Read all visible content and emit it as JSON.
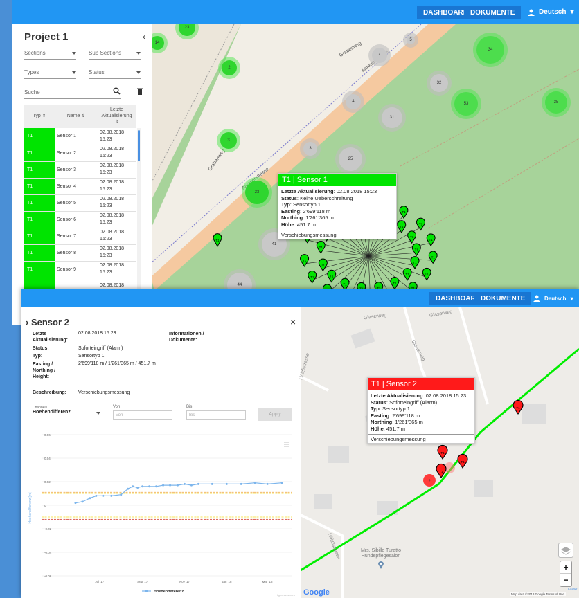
{
  "colors": {
    "topbar": "#2196f3",
    "nav_button": "#1976d2",
    "ok": "#00e400",
    "alarm": "#ff1a1a",
    "map_green": "#a7d39a"
  },
  "window1": {
    "nav": {
      "dashboard": "DASHBOARD",
      "dokumente": "DOKUMENTE",
      "language": "Deutsch"
    },
    "sidebar": {
      "title": "Project 1",
      "filters": {
        "sections": "Sections",
        "sub_sections": "Sub Sections",
        "types": "Types",
        "status": "Status",
        "search_placeholder": "Suche"
      },
      "headers": {
        "typ": "Typ",
        "name": "Name",
        "updated": "Letzte Aktualisierung"
      },
      "rows": [
        {
          "typ": "T1",
          "name": "Sensor 1",
          "date": "02.08.2018",
          "time": "15:23"
        },
        {
          "typ": "T1",
          "name": "Sensor 2",
          "date": "02.08.2018",
          "time": "15:23"
        },
        {
          "typ": "T1",
          "name": "Sensor 3",
          "date": "02.08.2018",
          "time": "15:23"
        },
        {
          "typ": "T1",
          "name": "Sensor 4",
          "date": "02.08.2018",
          "time": "15:23"
        },
        {
          "typ": "T1",
          "name": "Sensor 5",
          "date": "02.08.2018",
          "time": "15:23"
        },
        {
          "typ": "T1",
          "name": "Sensor 6",
          "date": "02.08.2018",
          "time": "15:23"
        },
        {
          "typ": "T1",
          "name": "Sensor 7",
          "date": "02.08.2018",
          "time": "15:23"
        },
        {
          "typ": "T1",
          "name": "Sensor 8",
          "date": "02.08.2018",
          "time": "15:23"
        },
        {
          "typ": "T1",
          "name": "Sensor 9",
          "date": "02.08.2018",
          "time": "15:23"
        },
        {
          "typ": "",
          "name": "",
          "date": "02.08.2018",
          "time": ""
        }
      ]
    },
    "map": {
      "street_labels": [
        "Grabenweg",
        "Aarauerstrasse",
        "Aarauerstrasse",
        "Grabenweg"
      ],
      "clusters": [
        "23",
        "2",
        "4",
        "34",
        "32",
        "53",
        "35",
        "4",
        "31",
        "3",
        "3",
        "25",
        "23",
        "41",
        "44",
        "14",
        "5"
      ],
      "popup": {
        "title": "T1 | Sensor 1",
        "updated_label": "Letzte Aktualisierung",
        "updated_value": "02.08.2018 15:23",
        "status_label": "Status",
        "status_value": "Keine Ueberschreitung",
        "typ_label": "Typ",
        "typ_value": "Sensortyp 1",
        "easting_label": "Easting",
        "easting_value": "2'699'118 m",
        "northing_label": "Northing",
        "northing_value": "1'261'365 m",
        "hoehe_label": "Höhe",
        "hoehe_value": "451.7 m",
        "footer": "Verschiebungsmessung"
      },
      "marker_label": "T1"
    }
  },
  "window2": {
    "nav": {
      "dashboard": "DASHBOARD",
      "dokumente": "DOKUMENTE",
      "language": "Deutsch"
    },
    "detail": {
      "title": "› Sensor 2",
      "close": "×",
      "updated_label": "Letzte Aktualisierung:",
      "updated_value": "02.08.2018 15:23",
      "info_label": "Informationen / Dokumente:",
      "status_label": "Status:",
      "status_value": "Soforteingriff (Alarm)",
      "typ_label": "Typ:",
      "typ_value": "Sensortyp 1",
      "coords_label": "Easting / Northing / Height:",
      "coords_value": "2'699'118 m / 1'261'365 m / 451.7 m",
      "beschreibung_label": "Beschreibung:",
      "beschreibung_value": "Verschiebungsmessung",
      "channels_label": "Channels",
      "channels_value": "Hoehendifferenz",
      "von_label": "Von",
      "von_placeholder": "Von",
      "bis_label": "Bis",
      "bis_placeholder": "Bis",
      "apply": "Apply",
      "credit": "Highcharts.com"
    },
    "map": {
      "street_labels": [
        "Glaserweg",
        "Glaserweg",
        "Glaserweg",
        "Hölzlistrasse",
        "Hölzlistrasse"
      ],
      "poi": "Mrs. Sibille Turatto Hundepflegesalon",
      "cluster": "2",
      "google": "Google",
      "attribution": "Map data ©2018 Google  Terms of Use",
      "leaflet": "Leaflet",
      "zoom_in": "+",
      "zoom_out": "−",
      "popup": {
        "title": "T1 | Sensor 2",
        "updated_label": "Letzte Aktualisierung",
        "updated_value": "02.08.2018 15:23",
        "status_label": "Status",
        "status_value": "Soforteingriff (Alarm)",
        "typ_label": "Typ",
        "typ_value": "Sensortyp 1",
        "easting_label": "Easting",
        "easting_value": "2'699'118 m",
        "northing_label": "Northing",
        "northing_value": "1'261'365 m",
        "hoehe_label": "Höhe",
        "hoehe_value": "451.7 m",
        "footer": "Verschiebungsmessung"
      },
      "marker_label": "T1"
    }
  },
  "chart_data": {
    "type": "line",
    "title": "",
    "xlabel": "",
    "ylabel": "Hoehendifferenz [m]",
    "x_ticks": [
      "Jul '17",
      "Sep '17",
      "Nov '17",
      "Jan '18",
      "Mar '18"
    ],
    "y_ticks": [
      "0.06",
      "0.04",
      "0.02",
      "0",
      "-0.02",
      "-0.04",
      "-0.06"
    ],
    "ylim": [
      -0.06,
      0.06
    ],
    "xlim": [
      "2017-06-01",
      "2018-04-20"
    ],
    "series": [
      {
        "name": "Hoehendifferenz",
        "color": "#7cb5ec",
        "x": [
          "2017-06-10",
          "2017-06-20",
          "2017-07-01",
          "2017-07-10",
          "2017-07-20",
          "2017-08-01",
          "2017-08-15",
          "2017-08-25",
          "2017-09-01",
          "2017-09-08",
          "2017-09-15",
          "2017-09-25",
          "2017-10-05",
          "2017-10-15",
          "2017-10-25",
          "2017-11-05",
          "2017-11-15",
          "2017-11-25",
          "2017-12-05",
          "2017-12-25",
          "2018-01-15",
          "2018-02-05",
          "2018-02-25",
          "2018-03-15",
          "2018-04-05"
        ],
        "values": [
          0.002,
          0.003,
          0.006,
          0.008,
          0.008,
          0.008,
          0.009,
          0.014,
          0.016,
          0.015,
          0.016,
          0.016,
          0.016,
          0.017,
          0.017,
          0.017,
          0.018,
          0.017,
          0.018,
          0.018,
          0.018,
          0.018,
          0.019,
          0.018,
          0.019
        ]
      }
    ],
    "thresholds": [
      {
        "value": 0.012,
        "color": "#d9534f"
      },
      {
        "value": 0.011,
        "color": "#f0ad4e"
      },
      {
        "value": 0.01,
        "color": "#f7e45a"
      },
      {
        "value": -0.012,
        "color": "#d9534f"
      },
      {
        "value": -0.011,
        "color": "#f0ad4e"
      },
      {
        "value": -0.01,
        "color": "#f7e45a"
      }
    ],
    "grid": true,
    "legend": "bottom-center"
  }
}
